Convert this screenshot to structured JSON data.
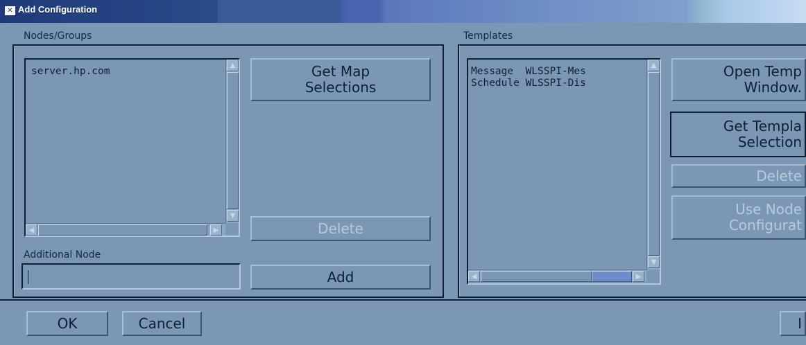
{
  "window": {
    "title": "Add Configuration",
    "app_icon": "window-menu-icon"
  },
  "nodes_groups": {
    "label": "Nodes/Groups",
    "items": [
      "server.hp.com"
    ],
    "get_map_selections_label": "Get Map\nSelections",
    "delete_label": "Delete",
    "additional_node_label": "Additional Node",
    "additional_node_value": "",
    "add_label": "Add"
  },
  "templates": {
    "label": "Templates",
    "items": [
      "Message  WLSSPI-Mes",
      "Schedule WLSSPI-Dis"
    ],
    "open_template_window_label": "Open Temp\nWindow.",
    "get_template_selections_label": "Get Templa\nSelection",
    "delete_label": "Delete",
    "use_node_configuration_label": "Use Node\nConfigurat"
  },
  "footer": {
    "ok_label": "OK",
    "cancel_label": "Cancel",
    "right_cut_label": "I"
  },
  "colors": {
    "window_bg": "#7b97b4",
    "titlebar": "#1f3a7a",
    "disabled_text": "#b9cadc",
    "scroll_thumb_active": "#6d8cc9"
  }
}
